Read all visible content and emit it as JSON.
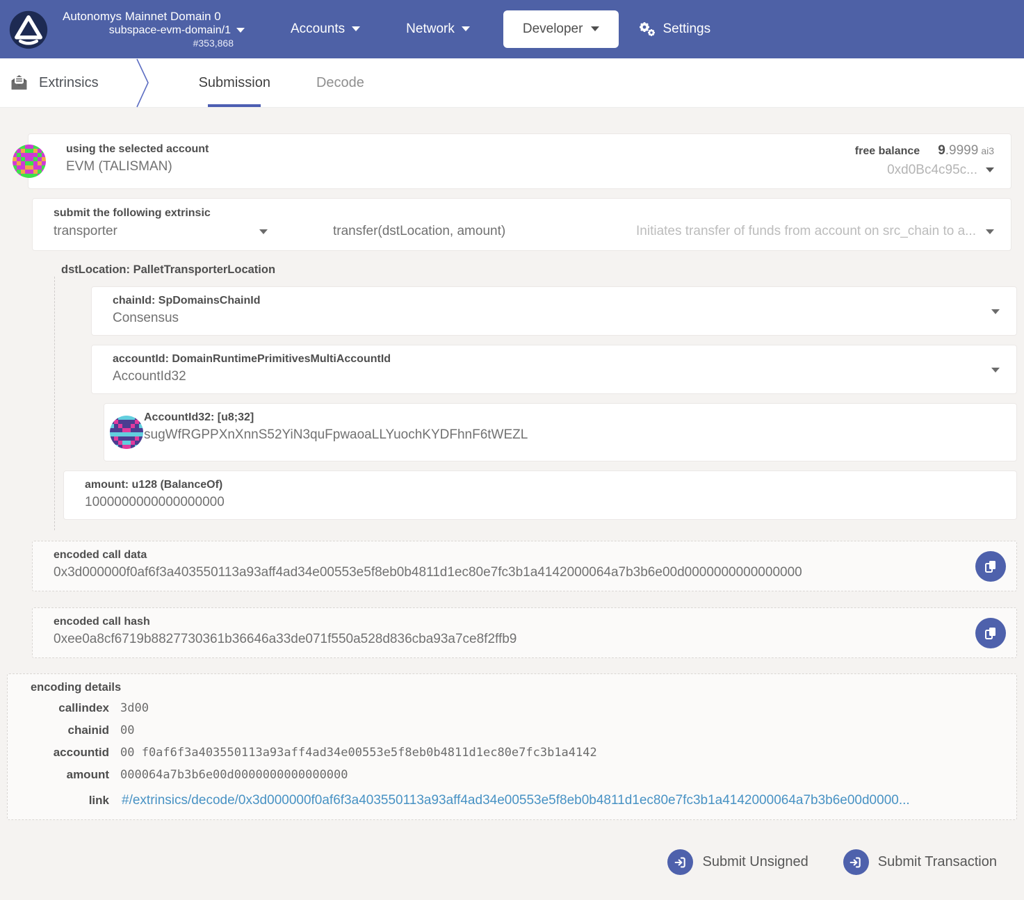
{
  "colors": {
    "header_bg": "#4e61a6",
    "accent": "#4e61ac",
    "link": "#4892c4",
    "page_bg": "#f5f3f1",
    "tab_underline": "#4d5eb2"
  },
  "header": {
    "chain_title": "Autonomys Mainnet Domain 0",
    "chain_sub": "subspace-evm-domain/1",
    "block_number": "#353,868",
    "nav_accounts": "Accounts",
    "nav_network": "Network",
    "nav_developer": "Developer",
    "nav_settings": "Settings"
  },
  "tabbar": {
    "section": "Extrinsics",
    "tab_submission": "Submission",
    "tab_decode": "Decode"
  },
  "account": {
    "label": "using the selected account",
    "name": "EVM (TALISMAN)",
    "free_balance_label": "free balance",
    "free_balance_int": "9",
    "free_balance_frac": ".9999",
    "free_balance_unit": "ai3",
    "address_short": "0xd0Bc4c95c..."
  },
  "extrinsic": {
    "label": "submit the following extrinsic",
    "pallet": "transporter",
    "call": "transfer(dstLocation, amount)",
    "hint": "Initiates transfer of funds from account on src_chain to a..."
  },
  "params": {
    "dst_location_label": "dstLocation: PalletTransporterLocation",
    "chain_id_label": "chainId: SpDomainsChainId",
    "chain_id_value": "Consensus",
    "account_id_label": "accountId: DomainRuntimePrimitivesMultiAccountId",
    "account_id_value": "AccountId32",
    "account32_label": "AccountId32: [u8;32]",
    "account32_value": "sugWfRGPPXnXnnS52YiN3quFpwaoaLLYuochKYDFhnF6tWEZL",
    "amount_label": "amount: u128 (BalanceOf)",
    "amount_value": "1000000000000000000"
  },
  "outputs": {
    "call_data_label": "encoded call data",
    "call_data": "0x3d000000f0af6f3a403550113a93aff4ad34e00553e5f8eb0b4811d1ec80e7fc3b1a4142000064a7b3b6e00d0000000000000000",
    "call_hash_label": "encoded call hash",
    "call_hash": "0xee0a8cf6719b8827730361b36646a33de071f550a528d836cba93a7ce8f2ffb9"
  },
  "encoding": {
    "title": "encoding details",
    "rows": [
      {
        "label": "callindex",
        "value": "3d00"
      },
      {
        "label": "chainid",
        "value": "00"
      },
      {
        "label": "accountid",
        "value": "00 f0af6f3a403550113a93aff4ad34e00553e5f8eb0b4811d1ec80e7fc3b1a4142"
      },
      {
        "label": "amount",
        "value": "000064a7b3b6e00d0000000000000000"
      }
    ],
    "link_label": "link",
    "link_value": "#/extrinsics/decode/0x3d000000f0af6f3a403550113a93aff4ad34e00553e5f8eb0b4811d1ec80e7fc3b1a4142000064a7b3b6e00d0000..."
  },
  "actions": {
    "submit_unsigned": "Submit Unsigned",
    "submit_transaction": "Submit Transaction"
  },
  "icons": {
    "logo": "autonomys-triangle-logo",
    "settings": "double-gear",
    "extrinsics": "envelope-document",
    "copy": "copy-documents",
    "submit": "sign-in-arrow",
    "dropdown": "caret-down"
  }
}
